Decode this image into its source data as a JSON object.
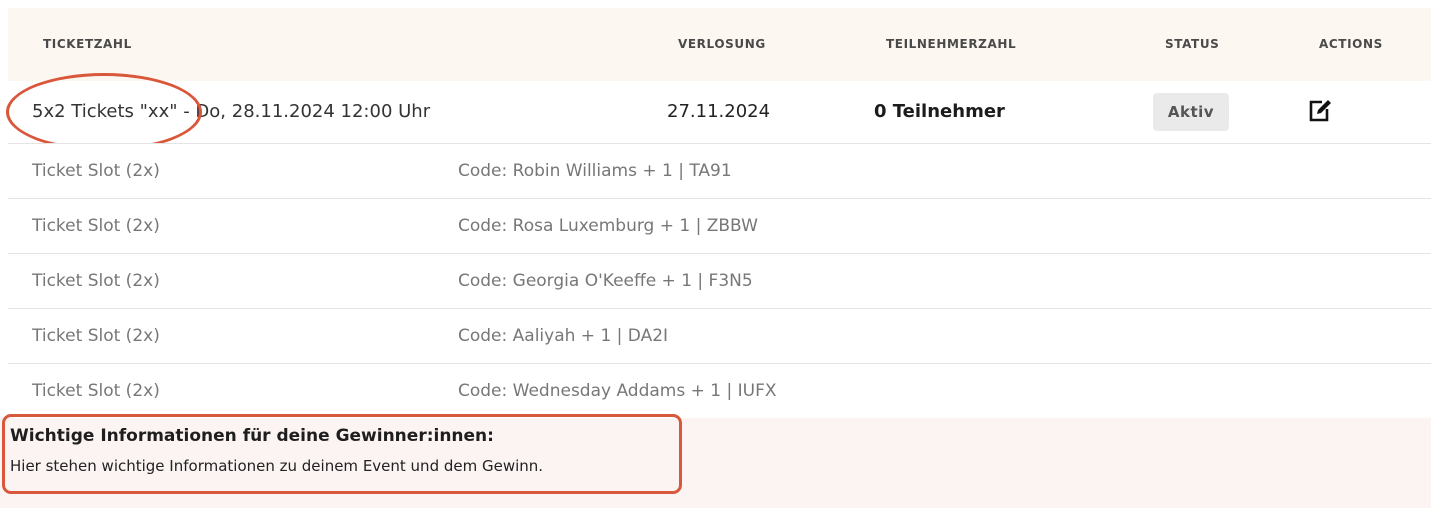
{
  "table": {
    "headers": {
      "ticketzahl": "TICKETZAHL",
      "verlosung": "VERLOSUNG",
      "teilnehmerzahl": "TEILNEHMERZAHL",
      "status": "STATUS",
      "actions": "ACTIONS"
    },
    "row": {
      "ticket": "5x2 Tickets \"xx\" - Do, 28.11.2024 12:00 Uhr",
      "verlosung": "27.11.2024",
      "teilnehmer": "0 Teilnehmer",
      "status": "Aktiv",
      "action_icon": "edit-icon"
    },
    "slots": [
      {
        "label": "Ticket Slot (2x)",
        "code": "Code: Robin Williams + 1 | TA91"
      },
      {
        "label": "Ticket Slot (2x)",
        "code": "Code: Rosa Luxemburg + 1 | ZBBW"
      },
      {
        "label": "Ticket Slot (2x)",
        "code": "Code: Georgia O'Keeffe + 1 | F3N5"
      },
      {
        "label": "Ticket Slot (2x)",
        "code": "Code: Aaliyah + 1 | DA2I"
      },
      {
        "label": "Ticket Slot (2x)",
        "code": "Code: Wednesday Addams + 1 | IUFX"
      }
    ]
  },
  "info": {
    "title": "Wichtige Informationen für deine Gewinner:innen:",
    "text": "Hier stehen wichtige Informationen zu deinem Event und dem Gewinn."
  },
  "colors": {
    "highlight": "#d9573a",
    "header_bg": "#fdf7f2",
    "info_bg": "#fcf4f3"
  }
}
